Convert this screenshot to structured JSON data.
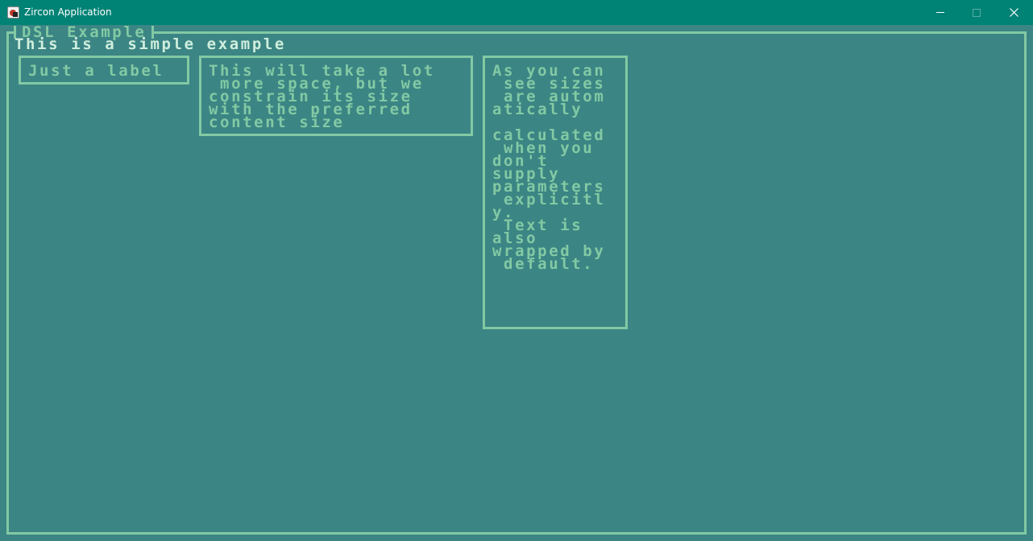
{
  "window": {
    "title": "Zircon Application",
    "icon": "zircon-app-icon",
    "controls": {
      "minimize": "minimize-icon",
      "maximize": "maximize-icon",
      "close": "close-icon"
    }
  },
  "panel": {
    "title": "DSL Example"
  },
  "header": {
    "text": "This is a simple example"
  },
  "label_box": {
    "text": "Just a label"
  },
  "constrained_box": {
    "text": "This will take a lot\n more space, but we\nconstrain its size\nwith the preferred\ncontent size"
  },
  "auto_box": {
    "text": "As you can\n see sizes\n are autom\natically\n\ncalculated\n when you\ndon't\nsupply\nparameters\n explicitl\ny.\n Text is\nalso\nwrapped by\n default."
  },
  "colors": {
    "background": "#3b8584",
    "accent": "#82c9a4",
    "titlebar": "#008275"
  }
}
